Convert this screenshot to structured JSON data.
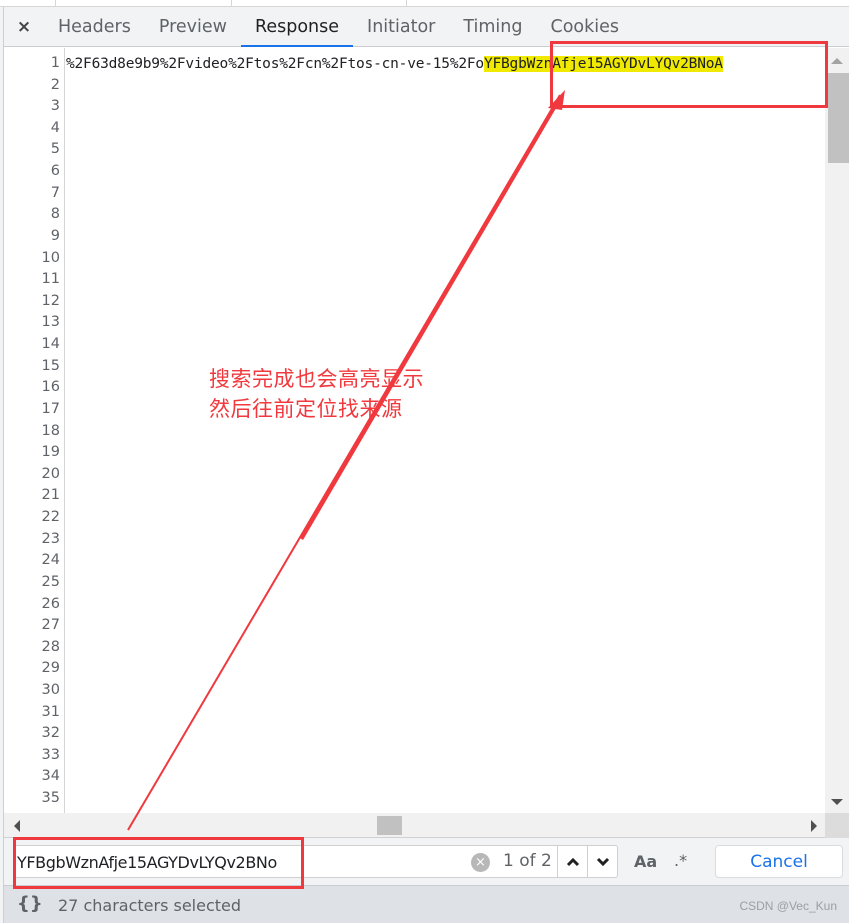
{
  "tabs": {
    "close_icon": "×",
    "items": [
      {
        "label": "Headers",
        "active": false
      },
      {
        "label": "Preview",
        "active": false
      },
      {
        "label": "Response",
        "active": true
      },
      {
        "label": "Initiator",
        "active": false
      },
      {
        "label": "Timing",
        "active": false
      },
      {
        "label": "Cookies",
        "active": false
      }
    ]
  },
  "editor": {
    "line_count": 35,
    "line1_prefix": "%2F63d8e9b9%2Fvideo%2Ftos%2Fcn%2Ftos-cn-ve-15%2Fo",
    "line1_highlight": "YFBgbWznAfje15AGYDvLYQv2BNoA"
  },
  "search": {
    "query": "YFBgbWznAfje15AGYDvLYQv2BNo",
    "clear_icon": "×",
    "match_count": "1 of 2",
    "match_case_label": "Aa",
    "regex_label": ".*",
    "cancel_label": "Cancel"
  },
  "status": {
    "format_icon": "{}",
    "text": "27 characters selected",
    "watermark": "CSDN @Vec_Kun"
  },
  "annotation": {
    "line1": "搜索完成也会高亮显示",
    "line2": "然后往前定位找来源",
    "color": "#f0393e"
  },
  "colors": {
    "accent": "#1a73e8",
    "highlight": "#f0e900",
    "annotation": "#f0393e"
  }
}
